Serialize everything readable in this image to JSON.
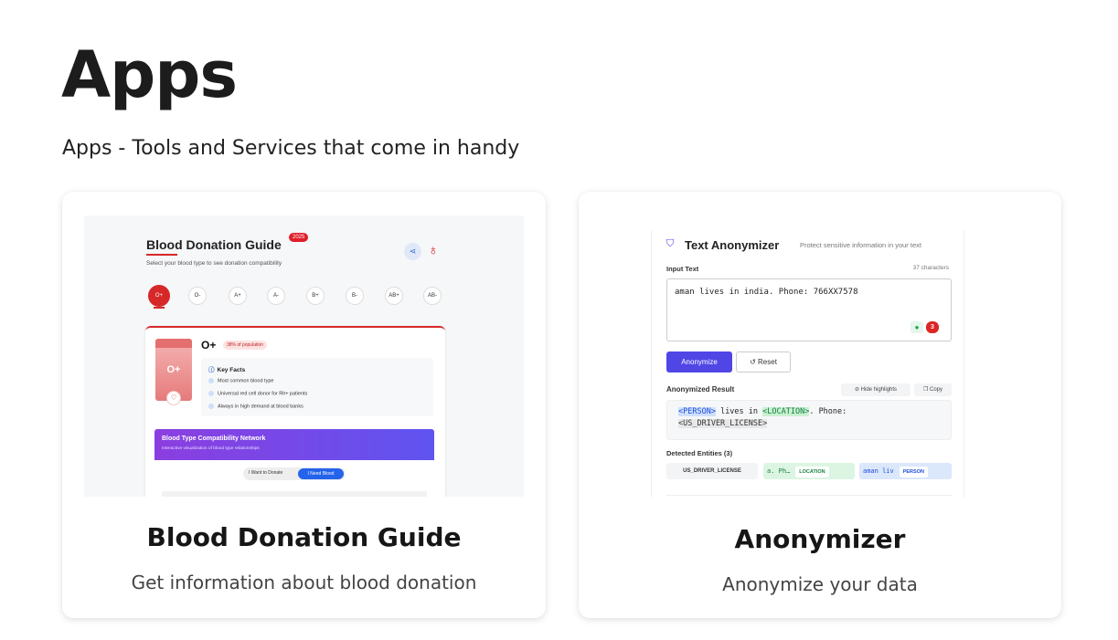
{
  "header": {
    "title": "Apps",
    "subtitle": "Apps - Tools and Services that come in handy"
  },
  "cards": [
    {
      "title": "Blood Donation Guide",
      "description": "Get information about blood donation",
      "thumbnail": {
        "app_title": "Blood Donation Guide",
        "year_badge": "2025",
        "subtitle": "Select your blood type to see donation compatibility",
        "blood_types": [
          "O+",
          "O-",
          "A+",
          "A-",
          "B+",
          "B-",
          "AB+",
          "AB-"
        ],
        "selected_type": "O+",
        "selected_type_big": "O+",
        "population_badge": "38% of population",
        "key_facts_title": "Key Facts",
        "key_facts": [
          "Most common blood type",
          "Universal red cell donor for Rh+ patients",
          "Always in high demand at blood banks"
        ],
        "network_title": "Blood Type Compatibility Network",
        "network_subtitle": "Interactive visualization of blood type relationships",
        "toggle_donate": "I Want to Donate",
        "toggle_need": "I Need Blood",
        "accent_color": "#d62828"
      }
    },
    {
      "title": "Anonymizer",
      "description": "Anonymize your data",
      "thumbnail": {
        "app_title": "Text Anonymizer",
        "tagline": "Protect sensitive information in your text",
        "input_label": "Input Text",
        "char_count": "37 characters",
        "input_value": "aman lives in india. Phone: 766XX7578",
        "badge_count": "3",
        "anonymize_button": "Anonymize",
        "reset_button": "Reset",
        "result_label": "Anonymized Result",
        "hide_highlights": "Hide highlights",
        "copy": "Copy",
        "result_person": "<PERSON>",
        "result_lives_in": " lives in ",
        "result_location": "<LOCATION>",
        "result_phone": ". Phone:",
        "result_license": "<US_DRIVER_LICENSE>",
        "entities_label": "Detected Entities (3)",
        "entities": [
          {
            "text": "",
            "type": "US_DRIVER_LICENSE"
          },
          {
            "text": "a. Ph…",
            "type": "LOCATION"
          },
          {
            "text": "aman liv",
            "type": "PERSON"
          }
        ],
        "accent_color": "#4f46e5"
      }
    }
  ]
}
